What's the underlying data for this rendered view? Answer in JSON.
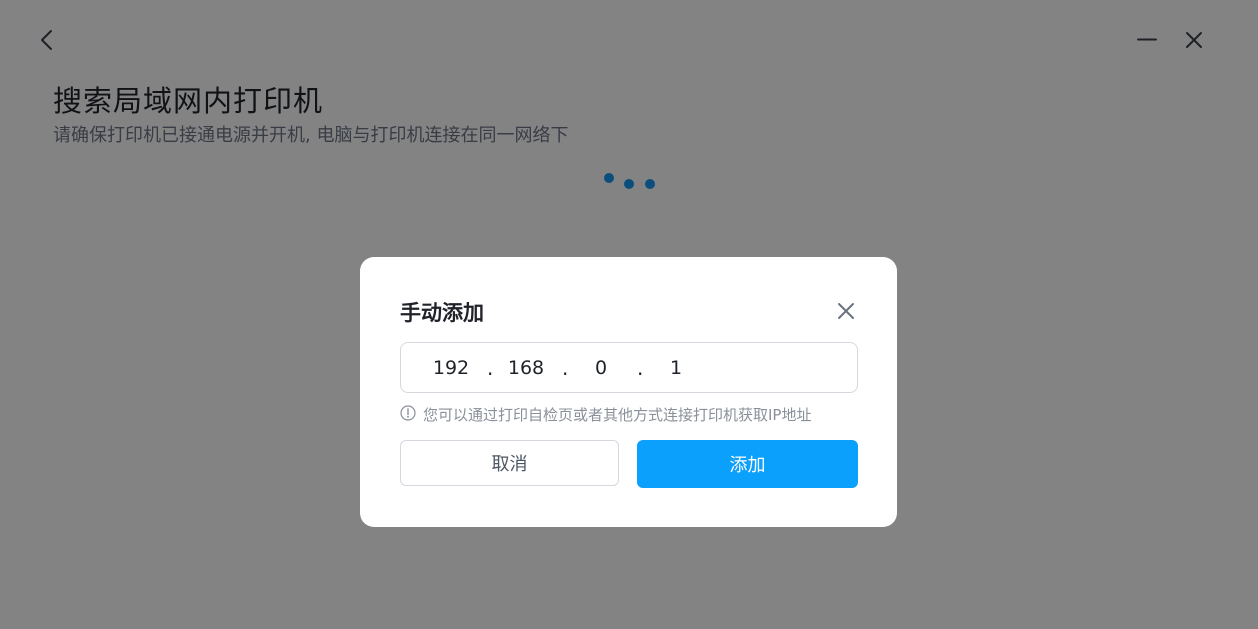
{
  "page": {
    "title": "搜索局域网内打印机",
    "subtitle": "请确保打印机已接通电源并开机, 电脑与打印机连接在同一网络下"
  },
  "icons": {
    "back": "chevron-left-icon",
    "minimize": "minimize-icon",
    "close": "close-icon",
    "info": "info-circle-icon",
    "loading": "loading-dots-icon"
  },
  "dialog": {
    "title": "手动添加",
    "ip": {
      "octet1": "192",
      "octet2": "168",
      "octet3": "0",
      "octet4": "1",
      "separator": "."
    },
    "hint": "您可以通过打印自检页或者其他方式连接打印机获取IP地址",
    "cancel_label": "取消",
    "add_label": "添加"
  },
  "colors": {
    "accent": "#0aa0fb",
    "loader": "#1592e8",
    "overlay": "rgba(0,0,0,0.47)"
  }
}
